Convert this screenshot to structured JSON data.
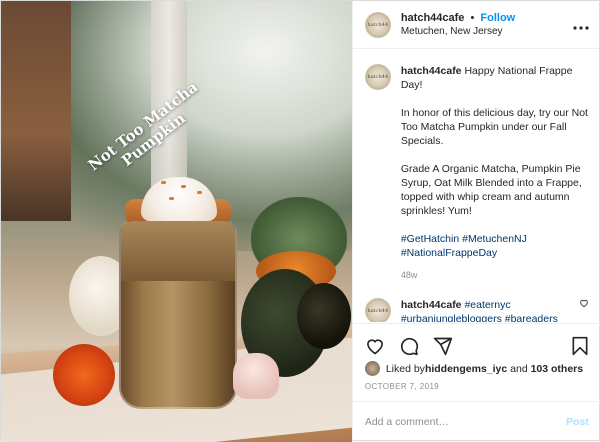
{
  "photo": {
    "overlay_text": "Not Too Matcha Pumpkin"
  },
  "header": {
    "username": "hatch44cafe",
    "separator": "•",
    "follow_label": "Follow",
    "location": "Metuchen, New Jersey",
    "more_icon": "more-horizontal-icon",
    "avatar_text": "hatch44"
  },
  "caption": {
    "username": "hatch44cafe",
    "text_line1": "Happy National Frappe Day!",
    "paragraph2": "In honor of this delicious day, try our Not Too Matcha Pumpkin under our Fall Specials.",
    "paragraph3": "Grade A Organic Matcha, Pumpkin Pie Syrup, Oat Milk Blended into a Frappe, topped with whip cream and autumn sprinkles! Yum!",
    "hashtags": "#GetHatchin #MetuchenNJ #NationalFrappeDay",
    "age": "48w"
  },
  "comment2": {
    "username": "hatch44cafe",
    "text": "#eaternyc #urbanjunglebloggers #bareaders #heresmyfood"
  },
  "actions": {
    "like_icon": "heart-icon",
    "comment_icon": "comment-icon",
    "share_icon": "share-icon",
    "save_icon": "bookmark-icon"
  },
  "likes": {
    "prefix": "Liked by ",
    "user": "hiddengems_iyc",
    "middle": " and ",
    "count": "103 others"
  },
  "date": "OCTOBER 7, 2019",
  "add_comment": {
    "placeholder": "Add a comment…",
    "post_label": "Post"
  },
  "colors": {
    "link_blue": "#0095f6",
    "hashtag": "#00376b",
    "muted": "#8e8e8e",
    "post_disabled": "#b2dffc"
  }
}
